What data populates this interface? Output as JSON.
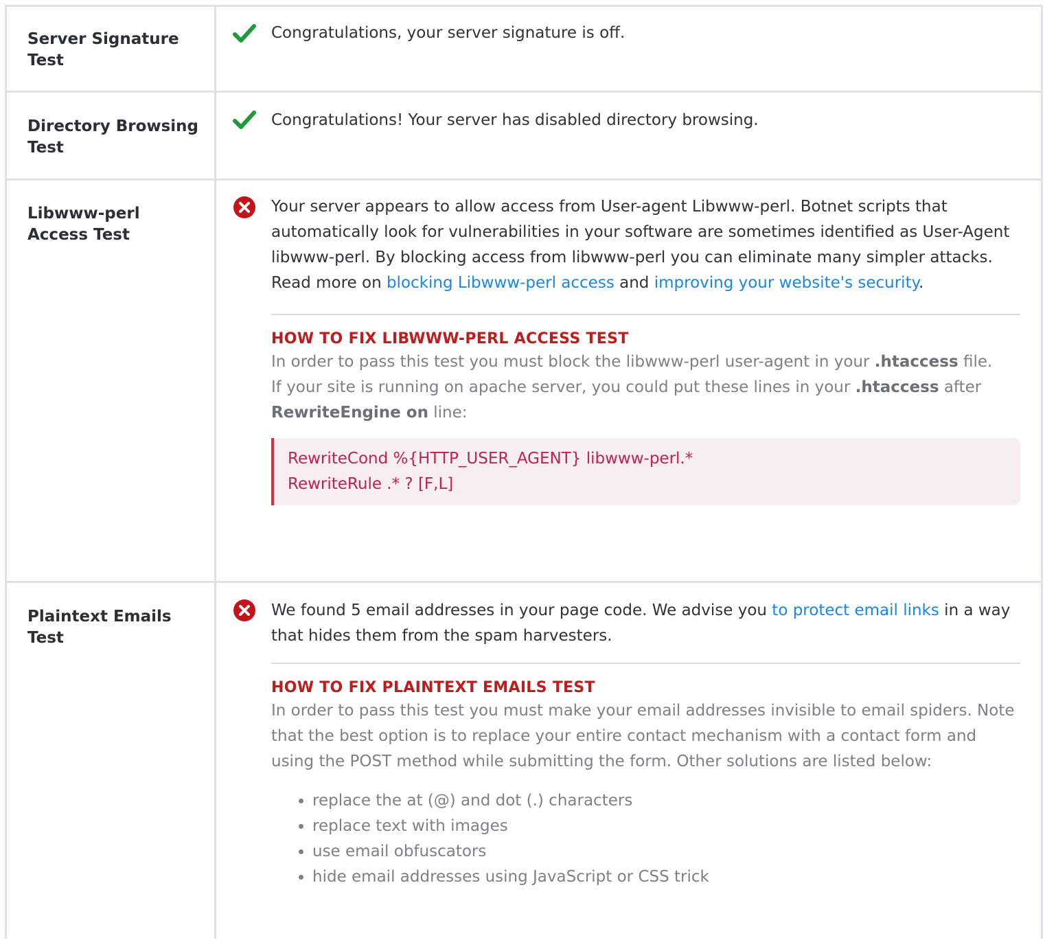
{
  "rows": [
    {
      "title": "Server Signature Test",
      "status": "pass",
      "message": "Congratulations, your server signature is off."
    },
    {
      "title": "Directory Browsing Test",
      "status": "pass",
      "message": "Congratulations! Your server has disabled directory browsing."
    },
    {
      "title": "Libwww-perl Access Test",
      "status": "fail",
      "message_part1": "Your server appears to allow access from User-agent Libwww-perl. Botnet scripts that automatically look for vulnerabilities in your software are sometimes identified as User-Agent libwww-perl. By blocking access from libwww-perl you can eliminate many simpler attacks. Read more on ",
      "link1": "blocking Libwww-perl access",
      "message_part2": " and ",
      "link2": "improving your website's security",
      "message_part3": ".",
      "fix_title": "HOW TO FIX LIBWWW-PERL ACCESS TEST",
      "fix_text1_a": "In order to pass this test you must block the libwww-perl user-agent in your ",
      "fix_text1_b": ".htaccess",
      "fix_text1_c": " file.",
      "fix_text2_a": "If your site is running on apache server, you could put these lines in your ",
      "fix_text2_b": ".htaccess",
      "fix_text2_c": " after ",
      "fix_text2_d": "RewriteEngine on",
      "fix_text2_e": " line:",
      "code_line1": "RewriteCond %{HTTP_USER_AGENT} libwww-perl.*",
      "code_line2": "RewriteRule .* ? [F,L]"
    },
    {
      "title": "Plaintext Emails Test",
      "status": "fail",
      "message_part1": "We found 5 email addresses in your page code. We advise you ",
      "link1": "to protect email links",
      "message_part2": " in a way that hides them from the spam harvesters.",
      "fix_title": "HOW TO FIX PLAINTEXT EMAILS TEST",
      "fix_text": "In order to pass this test you must make your email addresses invisible to email spiders. Note that the best option is to replace your entire contact mechanism with a contact form and using the POST method while submitting the form. Other solutions are listed below:",
      "fix_items": [
        "replace the at (@) and dot (.) characters",
        "replace text with images",
        "use email obfuscators",
        "hide email addresses using JavaScript or CSS trick"
      ]
    }
  ],
  "colors": {
    "pass": "#1e9a3a",
    "fail": "#c4141a",
    "link": "#1a86e8",
    "fix_title": "#bd1d1d",
    "code": "#c2214f"
  },
  "icons": {
    "pass": "check-icon",
    "fail": "error-circle-icon"
  }
}
